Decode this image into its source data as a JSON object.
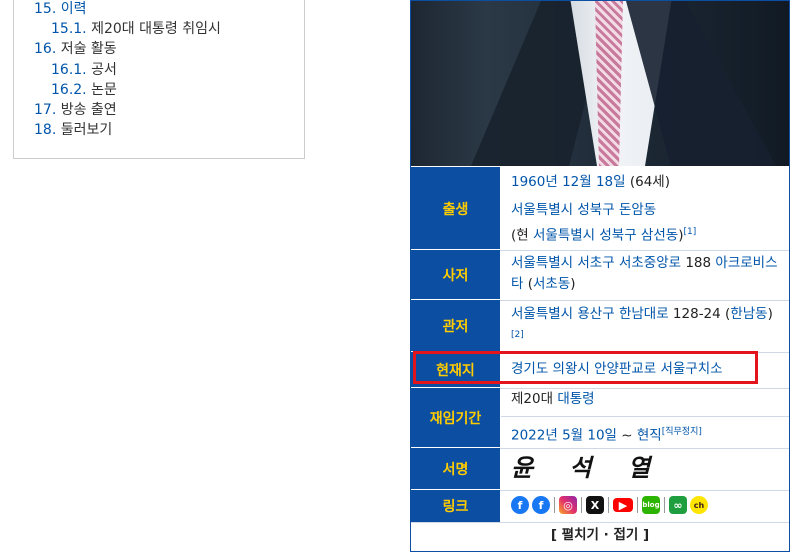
{
  "toc": [
    {
      "num": "15.",
      "text": "이력",
      "link": true
    },
    {
      "num": "15.1.",
      "text": "제20대 대통령 취임시",
      "link": false
    },
    {
      "num": "16.",
      "text": "저술 활동",
      "link": false
    },
    {
      "num": "16.1.",
      "text": "공서",
      "link": false
    },
    {
      "num": "16.2.",
      "text": "논문",
      "link": false
    },
    {
      "num": "17.",
      "text": "방송 출연",
      "link": false
    },
    {
      "num": "18.",
      "text": "둘러보기",
      "link": false
    }
  ],
  "infobox": {
    "birth": {
      "label": "출생",
      "date": "1960년 12월 18일",
      "age": "(64세)",
      "place": "서울특별시 성북구 돈암동",
      "paren_open": "(현 ",
      "current": "서울특별시 성북구 삼선동",
      "paren_close": ")",
      "ref": "[1]"
    },
    "residence": {
      "label": "사저",
      "addr_link": "서울특별시 서초구 서초중앙로",
      "addr_num": "188",
      "building": "아크로비스타",
      "dong": "서초동"
    },
    "official": {
      "label": "관저",
      "addr_link": "서울특별시 용산구 한남대로",
      "addr_num": "128-24",
      "dong": "한남동",
      "ref": "[2]"
    },
    "location": {
      "label": "현재지",
      "value": "경기도 의왕시 안양판교로 서울구치소"
    },
    "term": {
      "label": "재임기간",
      "ordinal": "제20대",
      "office": "대통령",
      "start": "2022년 5월 10일",
      "tilde": "~",
      "end": "현직",
      "note": "[직무정지]"
    },
    "signature": {
      "label": "서명",
      "value": "윤 석 열"
    },
    "links": {
      "label": "링크",
      "icons": [
        "facebook-icon",
        "facebook-icon",
        "instagram-icon",
        "x-icon",
        "youtube-icon",
        "blog-icon",
        "link-icon",
        "kakao-channel-icon"
      ]
    },
    "footer": "[ 펼치기 · 접기 ]"
  },
  "colors": {
    "header_bg": "#0b4ea2",
    "header_text": "#ffcc00",
    "link": "#0055aa",
    "highlight_box": "#e3141c"
  }
}
